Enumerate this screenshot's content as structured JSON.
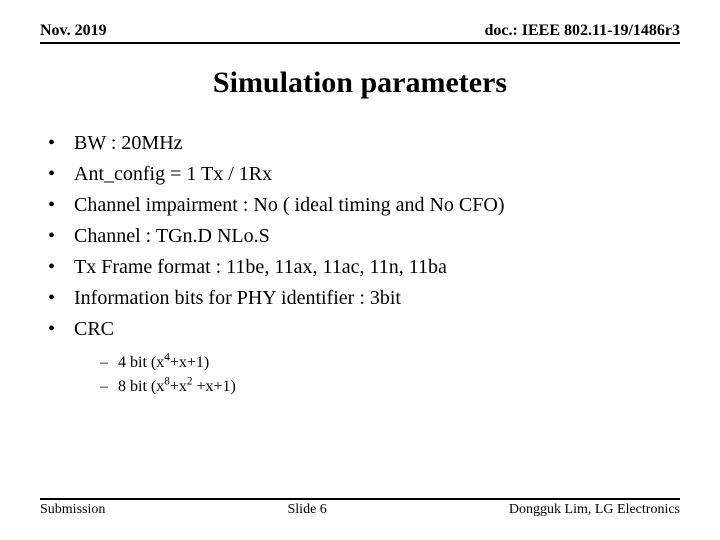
{
  "header": {
    "left": "Nov. 2019",
    "right": "doc.: IEEE 802.11-19/1486r3"
  },
  "title": "Simulation parameters",
  "bullets": [
    "BW : 20MHz",
    "Ant_config = 1 Tx / 1Rx",
    "Channel impairment : No ( ideal timing and No CFO)",
    "Channel : TGn.D NLo.S",
    "Tx Frame format : 11be, 11ax, 11ac, 11n, 11ba",
    "Information bits for PHY identifier : 3bit",
    "CRC"
  ],
  "sub_bullets": [
    {
      "prefix": "4 bit (x",
      "sup1": "4",
      "mid": "+x+1)"
    },
    {
      "prefix": "8 bit (x",
      "sup1": "8",
      "mid": "+x",
      "sup2": "2",
      "suffix": " +x+1)"
    }
  ],
  "footer": {
    "left": "Submission",
    "center": "Slide 6",
    "right": "Dongguk Lim, LG Electronics"
  }
}
